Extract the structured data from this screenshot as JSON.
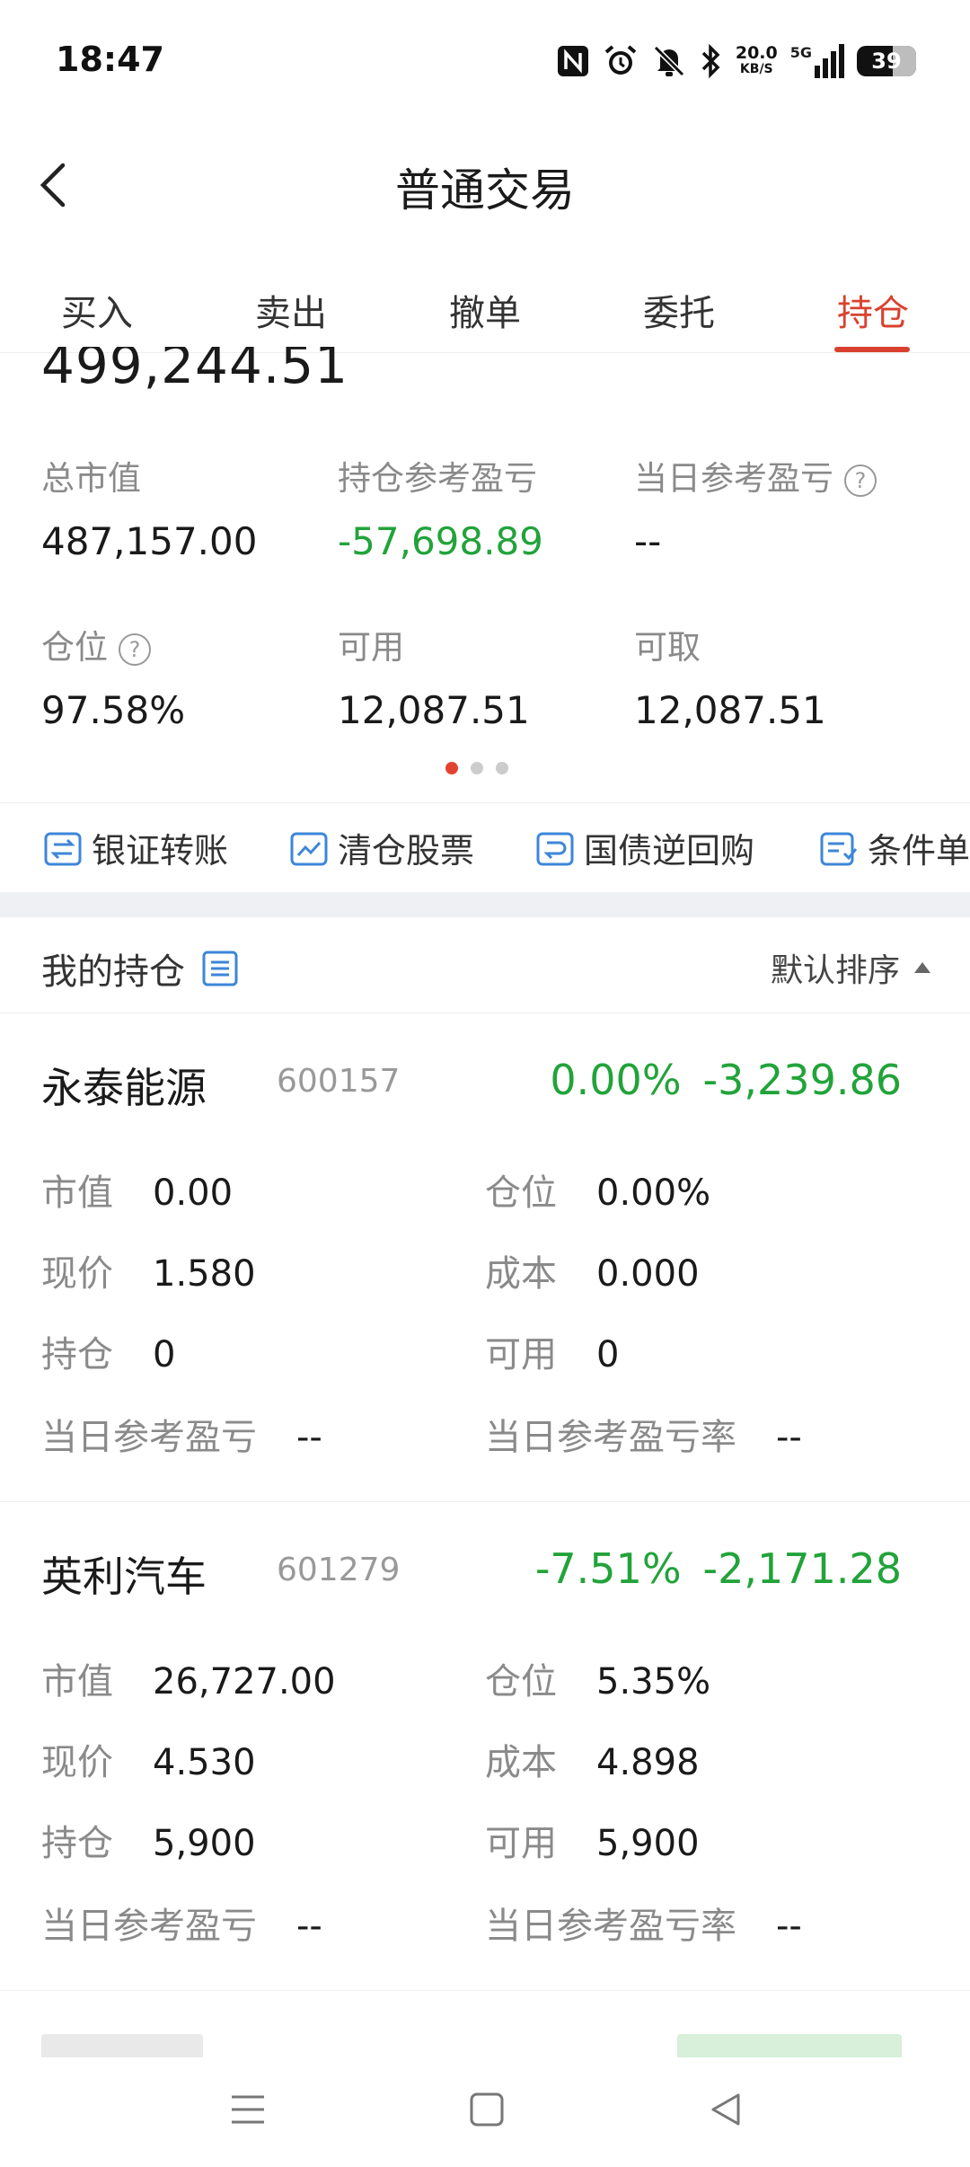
{
  "status_bar": {
    "time": "18:47",
    "net_speed_value": "20.0",
    "net_speed_unit": "KB/S",
    "signal_label": "5G",
    "battery": "39",
    "icons": [
      "nfc-icon",
      "alarm-icon",
      "mute-icon",
      "bluetooth-icon",
      "signal-icon",
      "battery-icon"
    ]
  },
  "header": {
    "title": "普通交易"
  },
  "tabs": [
    {
      "label": "买入"
    },
    {
      "label": "卖出"
    },
    {
      "label": "撤单"
    },
    {
      "label": "委托"
    },
    {
      "label": "持仓",
      "active": true
    }
  ],
  "summary": {
    "total_asset_partial": "499,244.51",
    "total_market_value_label": "总市值",
    "total_market_value": "487,157.00",
    "position_pnl_label": "持仓参考盈亏",
    "position_pnl": "-57,698.89",
    "today_pnl_label": "当日参考盈亏",
    "today_pnl": "--",
    "position_ratio_label": "仓位",
    "position_ratio": "97.58%",
    "available_label": "可用",
    "available": "12,087.51",
    "withdrawable_label": "可取",
    "withdrawable": "12,087.51",
    "help_glyph": "?"
  },
  "quick_actions": [
    {
      "label": "银证转账",
      "icon": "transfer-icon"
    },
    {
      "label": "清仓股票",
      "icon": "chart-clear-icon"
    },
    {
      "label": "国债逆回购",
      "icon": "repo-icon"
    },
    {
      "label": "条件单",
      "icon": "condition-order-icon"
    }
  ],
  "holdings_header": {
    "title": "我的持仓",
    "sort_label": "默认排序"
  },
  "field_labels": {
    "market_value": "市值",
    "position": "仓位",
    "price": "现价",
    "cost": "成本",
    "holding": "持仓",
    "available": "可用",
    "today_pnl": "当日参考盈亏",
    "today_pnl_rate": "当日参考盈亏率"
  },
  "holdings": [
    {
      "name": "永泰能源",
      "code": "600157",
      "pnl_pct": "0.00%",
      "pnl": "-3,239.86",
      "market_value": "0.00",
      "position": "0.00%",
      "price": "1.580",
      "cost": "0.000",
      "holding": "0",
      "available": "0",
      "today_pnl": "--",
      "today_pnl_rate": "--"
    },
    {
      "name": "英利汽车",
      "code": "601279",
      "pnl_pct": "-7.51%",
      "pnl": "-2,171.28",
      "market_value": "26,727.00",
      "position": "5.35%",
      "price": "4.530",
      "cost": "4.898",
      "holding": "5,900",
      "available": "5,900",
      "today_pnl": "--",
      "today_pnl_rate": "--"
    }
  ],
  "colors": {
    "accent": "#d9412e",
    "down": "#22a33a",
    "icon_blue": "#3d86d8"
  }
}
